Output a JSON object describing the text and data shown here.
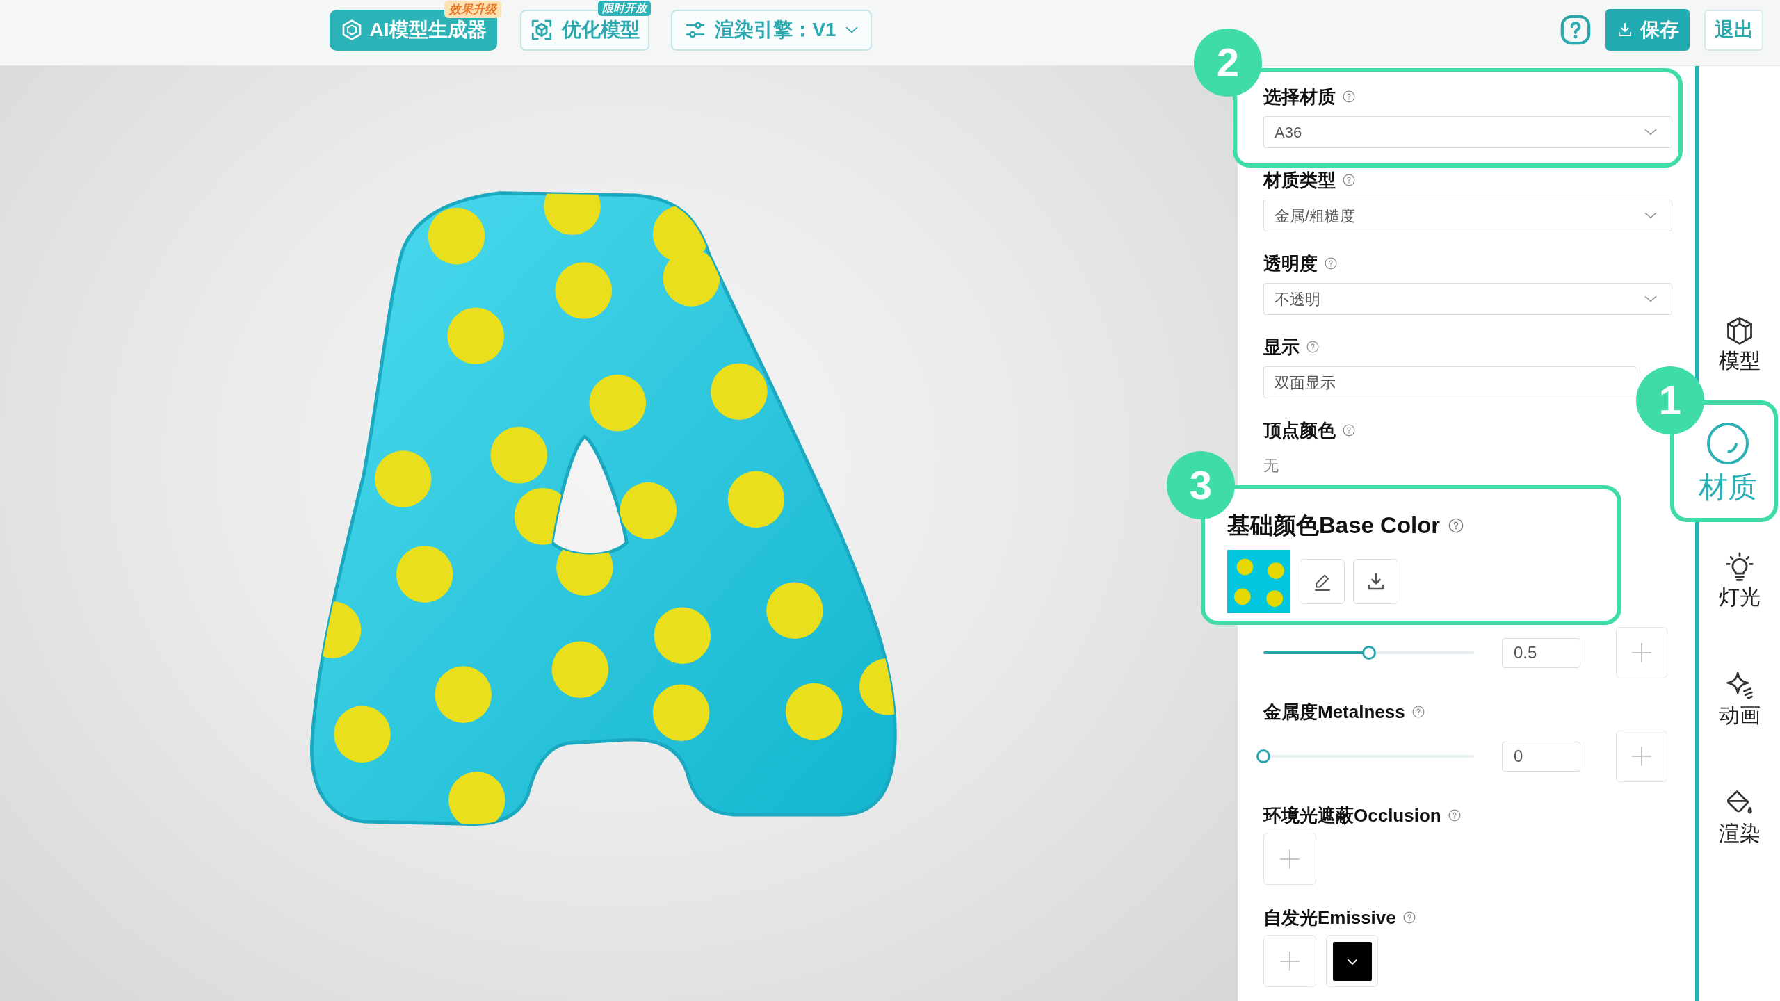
{
  "toolbar": {
    "buttons": [
      {
        "kind": "generator",
        "label": "AI模型生成器",
        "badge": {
          "kind": "upgrade",
          "text": "效果升级"
        }
      },
      {
        "kind": "optimize",
        "label": "优化模型",
        "badge": {
          "kind": "limited",
          "text": "限时开放"
        }
      },
      {
        "kind": "engine",
        "label": "渲染引擎：V1"
      }
    ],
    "actions": [
      {
        "kind": "help"
      },
      {
        "kind": "save",
        "label": "保存"
      },
      {
        "kind": "exit",
        "label": "退出"
      }
    ]
  },
  "material_panel": {
    "fields": [
      {
        "kind": "select",
        "label": "选择材质",
        "help": true,
        "value": "A36",
        "callout": "2"
      },
      {
        "kind": "select",
        "label": "材质类型",
        "help": true,
        "value": "金属/粗糙度"
      },
      {
        "kind": "select",
        "label": "透明度",
        "help": true,
        "value": "不透明"
      },
      {
        "kind": "input",
        "label": "显示",
        "help": true,
        "value": "双面显示"
      },
      {
        "kind": "text",
        "label": "顶点颜色",
        "help": true,
        "value": "无"
      },
      {
        "kind": "texture",
        "label": "基础颜色Base Color",
        "help": true,
        "callout": "3"
      },
      {
        "kind": "slider",
        "level": 0.5,
        "reading": "0.5"
      },
      {
        "kind": "slider",
        "label": "金属度Metalness",
        "help": true,
        "level": 0,
        "reading": "0"
      },
      {
        "kind": "map_slot",
        "label": "环境光遮蔽Occlusion",
        "help": true
      },
      {
        "kind": "emissive",
        "label": "自发光Emissive",
        "help": true,
        "color": "#000000"
      }
    ]
  },
  "sidebar": {
    "items": [
      {
        "kind": "model",
        "label": "模型",
        "selected": false
      },
      {
        "kind": "material",
        "label": "材质",
        "selected": true,
        "callout": "1"
      },
      {
        "kind": "light",
        "label": "灯光",
        "selected": false
      },
      {
        "kind": "animation",
        "label": "动画",
        "selected": false
      },
      {
        "kind": "render",
        "label": "渲染",
        "selected": false
      }
    ]
  }
}
